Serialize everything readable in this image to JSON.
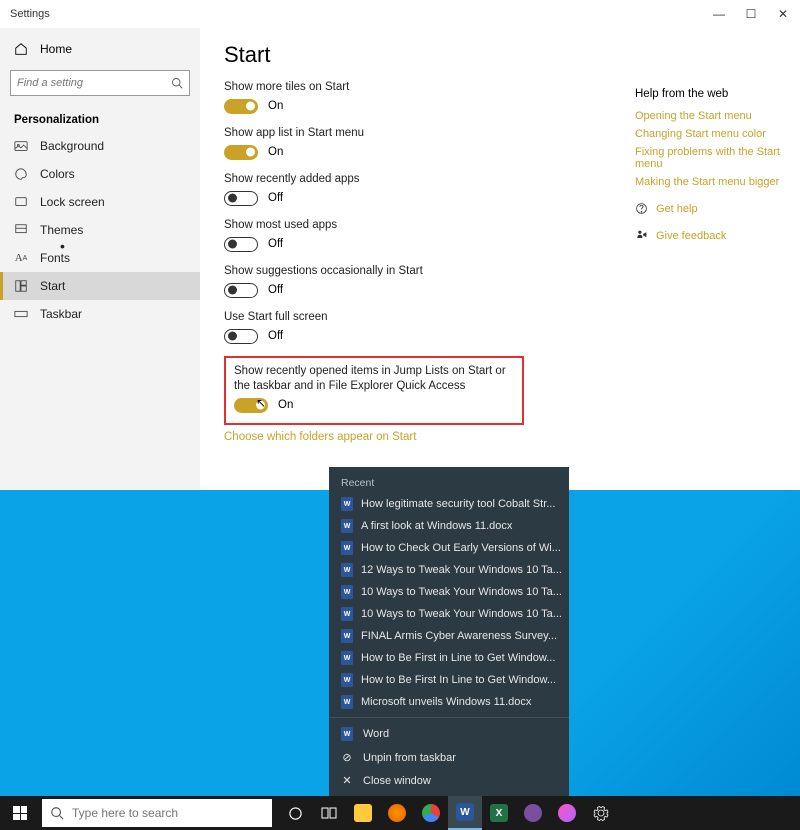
{
  "titlebar": {
    "title": "Settings"
  },
  "sidebar": {
    "home": "Home",
    "search_placeholder": "Find a setting",
    "section": "Personalization",
    "items": [
      {
        "label": "Background"
      },
      {
        "label": "Colors"
      },
      {
        "label": "Lock screen"
      },
      {
        "label": "Themes"
      },
      {
        "label": "Fonts"
      },
      {
        "label": "Start"
      },
      {
        "label": "Taskbar"
      }
    ]
  },
  "page": {
    "title": "Start",
    "settings": [
      {
        "label": "Show more tiles on Start",
        "on": true,
        "state": "On"
      },
      {
        "label": "Show app list in Start menu",
        "on": true,
        "state": "On"
      },
      {
        "label": "Show recently added apps",
        "on": false,
        "state": "Off"
      },
      {
        "label": "Show most used apps",
        "on": false,
        "state": "Off"
      },
      {
        "label": "Show suggestions occasionally in Start",
        "on": false,
        "state": "Off"
      },
      {
        "label": "Use Start full screen",
        "on": false,
        "state": "Off"
      },
      {
        "label": "Show recently opened items in Jump Lists on Start or the taskbar and in File Explorer Quick Access",
        "on": true,
        "state": "On"
      }
    ],
    "folders_link": "Choose which folders appear on Start"
  },
  "help": {
    "title": "Help from the web",
    "links": [
      "Opening the Start menu",
      "Changing Start menu color",
      "Fixing problems with the Start menu",
      "Making the Start menu bigger"
    ],
    "get_help": "Get help",
    "feedback": "Give feedback"
  },
  "jumplist": {
    "header": "Recent",
    "items": [
      "How legitimate security tool Cobalt Str...",
      "A first look at Windows 11.docx",
      "How to Check Out Early Versions of Wi...",
      "12 Ways to Tweak Your Windows 10 Ta...",
      "10 Ways to Tweak Your Windows 10 Ta...",
      "10 Ways to Tweak Your Windows 10 Ta...",
      "FINAL Armis Cyber Awareness Survey...",
      "How to Be First in Line to Get Window...",
      "How to Be First In Line to Get Window...",
      "Microsoft unveils Windows 11.docx"
    ],
    "app": "Word",
    "unpin": "Unpin from taskbar",
    "close": "Close window"
  },
  "taskbar": {
    "search_placeholder": "Type here to search"
  }
}
